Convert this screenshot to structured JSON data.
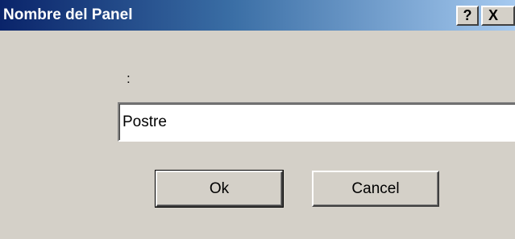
{
  "window": {
    "title": "Nombre del Panel",
    "help_button_label": "?",
    "close_button_label": "X"
  },
  "form": {
    "prompt_label": ":",
    "name_value": "Postre"
  },
  "buttons": {
    "ok_label": "Ok",
    "cancel_label": "Cancel"
  },
  "colors": {
    "title_bar_start": "#0a246a",
    "title_bar_end": "#a6caf0",
    "dialog_background": "#d4d0c8"
  }
}
